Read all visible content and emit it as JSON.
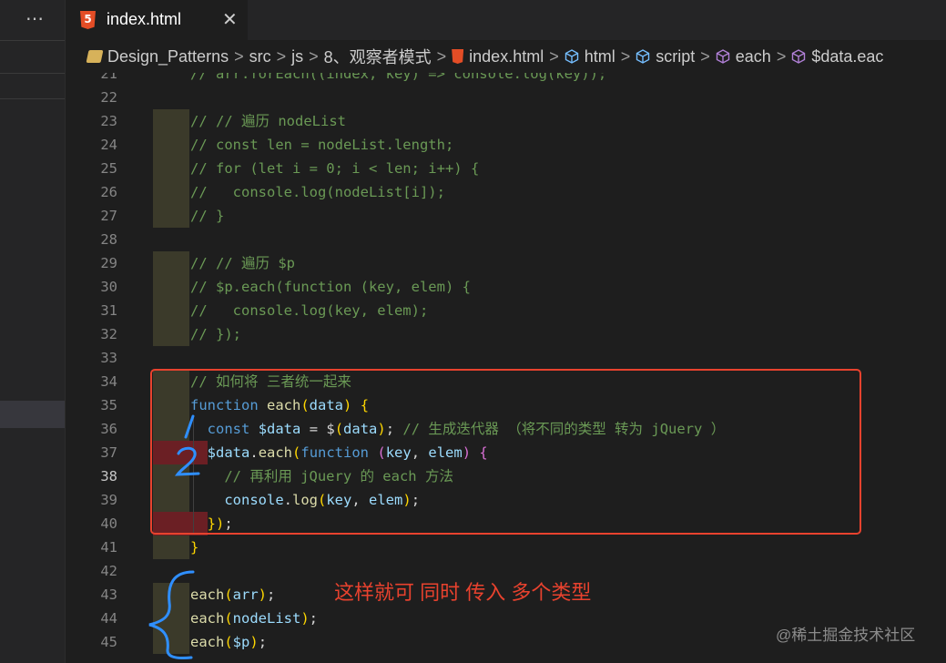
{
  "sidebar": {
    "more_icon": "⋯"
  },
  "tab": {
    "label": "index.html",
    "close": "✕",
    "html5_badge": "5"
  },
  "breadcrumbs": [
    {
      "label": "Design_Patterns",
      "icon": "folder-icon"
    },
    {
      "label": "src",
      "icon": ""
    },
    {
      "label": "js",
      "icon": ""
    },
    {
      "label": "8、观察者模式",
      "icon": ""
    },
    {
      "label": "index.html",
      "icon": "html5-icon"
    },
    {
      "label": "html",
      "icon": "cube-icon"
    },
    {
      "label": "script",
      "icon": "cube-icon"
    },
    {
      "label": "each",
      "icon": "cube-purple-icon"
    },
    {
      "label": "$data.eac",
      "icon": "cube-purple-icon"
    }
  ],
  "lines": [
    {
      "num": "21",
      "text": "// arr.forEach((index, key) => console.log(key));"
    },
    {
      "num": "22",
      "text": ""
    },
    {
      "num": "23",
      "text": "// // 遍历 nodeList"
    },
    {
      "num": "24",
      "text": "// const len = nodeList.length;"
    },
    {
      "num": "25",
      "text": "// for (let i = 0; i < len; i++) {"
    },
    {
      "num": "26",
      "text": "//   console.log(nodeList[i]);"
    },
    {
      "num": "27",
      "text": "// }"
    },
    {
      "num": "28",
      "text": ""
    },
    {
      "num": "29",
      "text": "// // 遍历 $p"
    },
    {
      "num": "30",
      "text": "// $p.each(function (key, elem) {"
    },
    {
      "num": "31",
      "text": "//   console.log(key, elem);"
    },
    {
      "num": "32",
      "text": "// });"
    },
    {
      "num": "33",
      "text": ""
    },
    {
      "num": "34",
      "text": "// 如何将 三者统一起来"
    },
    {
      "num": "35",
      "text": "function each(data) {"
    },
    {
      "num": "36",
      "text": "  const $data = $(data); // 生成迭代器 （将不同的类型 转为 jQuery ）"
    },
    {
      "num": "37",
      "text": "  $data.each(function (key, elem) {"
    },
    {
      "num": "38",
      "text": "    // 再利用 jQuery 的 each 方法"
    },
    {
      "num": "39",
      "text": "    console.log(key, elem);"
    },
    {
      "num": "40",
      "text": "  });"
    },
    {
      "num": "41",
      "text": "}"
    },
    {
      "num": "42",
      "text": ""
    },
    {
      "num": "43",
      "text": "each(arr);"
    },
    {
      "num": "44",
      "text": "each(nodeList);"
    },
    {
      "num": "45",
      "text": "each($p);"
    }
  ],
  "current_line": "38",
  "annotations": {
    "note": "这样就可 同时 传入 多个类型",
    "mark_1": "1",
    "mark_2": "2"
  },
  "watermark": "@稀土掘金技术社区",
  "colors": {
    "annotation": "#e8422e",
    "handwriting": "#2f8fff"
  }
}
